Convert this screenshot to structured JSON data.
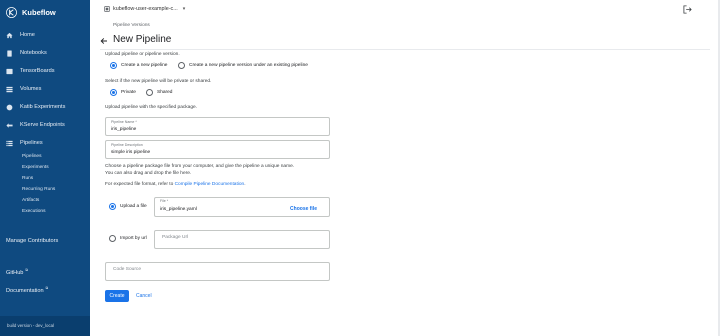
{
  "app": {
    "logo_text": "Kubeflow",
    "accent": "#1a73e8",
    "sidebar_bg": "#0f4a80"
  },
  "sidebar": {
    "items": [
      {
        "icon": "home-icon",
        "label": "Home"
      },
      {
        "icon": "notebook-icon",
        "label": "Notebooks"
      },
      {
        "icon": "tensorboard-icon",
        "label": "TensorBoards"
      },
      {
        "icon": "volumes-icon",
        "label": "Volumes"
      },
      {
        "icon": "katib-icon",
        "label": "Katib Experiments"
      },
      {
        "icon": "kserve-icon",
        "label": "KServe Endpoints"
      },
      {
        "icon": "pipelines-icon",
        "label": "Pipelines"
      }
    ],
    "subitems": [
      "Pipelines",
      "Experiments",
      "Runs",
      "Recurring Runs",
      "Artifacts",
      "Executions"
    ],
    "manage_contributors": "Manage Contributors",
    "github": "GitHub",
    "documentation": "Documentation",
    "build_version": "build version - dev_local"
  },
  "topbar": {
    "namespace": "kubeflow-user-example-c...",
    "logout_icon": "logout-icon"
  },
  "page": {
    "breadcrumb": "Pipeline Versions",
    "title": "New Pipeline",
    "upload_prompt": "Upload pipeline or pipeline version.",
    "opt_new_pipeline": "Create a new pipeline",
    "opt_new_version": "Create a new pipeline version under an existing pipeline",
    "visibility_prompt": "Select if the new pipeline will be private or shared.",
    "opt_private": "Private",
    "opt_shared": "Shared",
    "package_prompt": "Upload pipeline with the specified package.",
    "name_label": "Pipeline Name *",
    "name_value": "iris_pipeline",
    "desc_label": "Pipeline Description",
    "desc_value": "simple iris pipeline",
    "choose_help_1": "Choose a pipeline package file from your computer, and give the pipeline a unique name.",
    "choose_help_2": "You can also drag and drop the file here.",
    "format_prefix": "For expected file format, refer to ",
    "format_link": "Compile Pipeline Documentation",
    "format_suffix": ".",
    "opt_upload_file": "Upload a file",
    "file_label": "File *",
    "file_value": "iris_pipeline.yaml",
    "choose_file": "Choose file",
    "opt_import_url": "Import by url",
    "url_placeholder": "Package Url",
    "code_source_placeholder": "Code Source",
    "create_label": "Create",
    "cancel_label": "Cancel"
  }
}
